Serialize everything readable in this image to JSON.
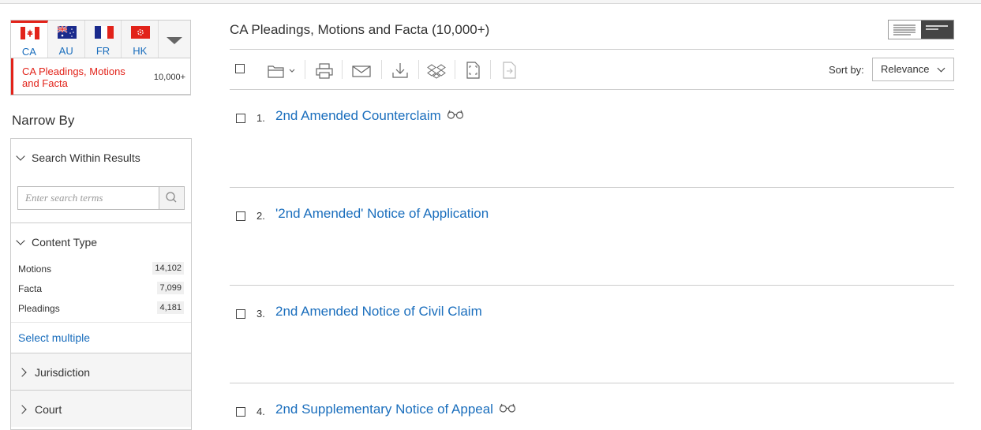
{
  "jurisdiction_tabs": [
    {
      "code": "CA",
      "flag": "canada-flag"
    },
    {
      "code": "AU",
      "flag": "australia-flag"
    },
    {
      "code": "FR",
      "flag": "france-flag"
    },
    {
      "code": "HK",
      "flag": "hong-kong-flag"
    }
  ],
  "source": {
    "name": "CA Pleadings, Motions and Facta",
    "count": "10,000+"
  },
  "narrow_by": "Narrow By",
  "facets": {
    "search_within": {
      "label": "Search Within Results",
      "placeholder": "Enter search terms"
    },
    "content_type": {
      "label": "Content Type",
      "items": [
        {
          "label": "Motions",
          "count": "14,102"
        },
        {
          "label": "Facta",
          "count": "7,099"
        },
        {
          "label": "Pleadings",
          "count": "4,181"
        }
      ],
      "select_multiple": "Select multiple"
    },
    "jurisdiction": {
      "label": "Jurisdiction"
    },
    "court": {
      "label": "Court"
    }
  },
  "main": {
    "title": "CA Pleadings, Motions and Facta (10,000+)",
    "sort_label": "Sort by:",
    "sort_value": "Relevance"
  },
  "results": [
    {
      "index": "1.",
      "title": "2nd Amended Counterclaim",
      "preview": true
    },
    {
      "index": "2.",
      "title": "'2nd Amended' Notice of Application",
      "preview": false
    },
    {
      "index": "3.",
      "title": "2nd Amended Notice of Civil Claim",
      "preview": false
    },
    {
      "index": "4.",
      "title": "2nd Supplementary Notice of Appeal",
      "preview": true
    }
  ],
  "colors": {
    "accent_red": "#e2231a",
    "link_blue": "#1a6ebd"
  }
}
